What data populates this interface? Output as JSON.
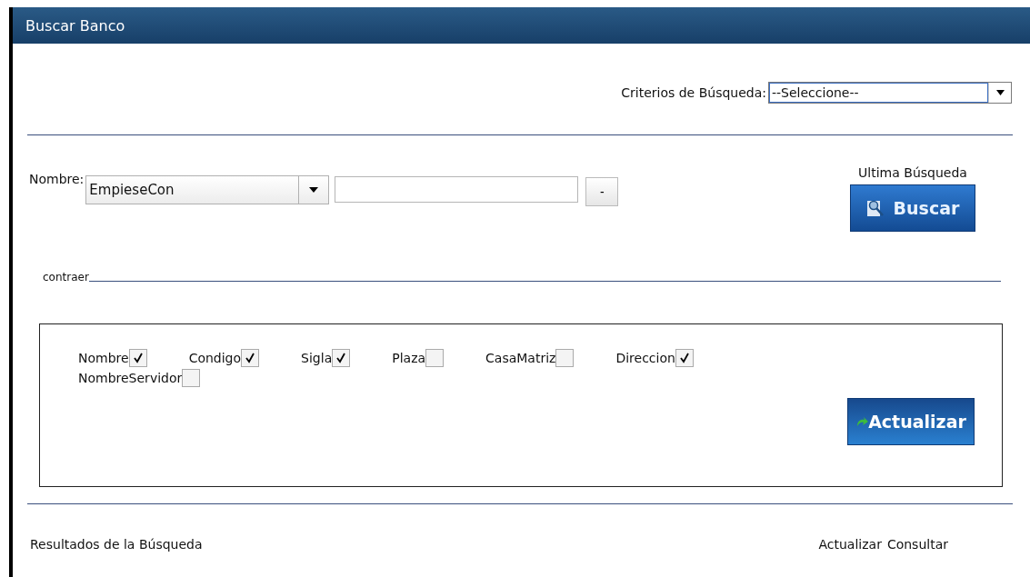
{
  "window": {
    "title": "Buscar Banco"
  },
  "criteria": {
    "label": "Criterios de Búsqueda:",
    "value": "--Seleccione--"
  },
  "name_filter": {
    "label": "Nombre:",
    "operator": "EmpieseCon",
    "remove_button": "-"
  },
  "last_search": {
    "label": "Ultima Búsqueda",
    "button": "Buscar"
  },
  "collapse": {
    "label": "contraer"
  },
  "columns": [
    {
      "label": "Nombre",
      "checked": true
    },
    {
      "label": "Condigo",
      "checked": true
    },
    {
      "label": "Sigla",
      "checked": true
    },
    {
      "label": "Plaza",
      "checked": false
    },
    {
      "label": "CasaMatriz",
      "checked": false
    },
    {
      "label": "Direccion",
      "checked": true
    },
    {
      "label": "NombreServidor",
      "checked": false
    }
  ],
  "update_button": "Actualizar",
  "results": {
    "title": "Resultados de la Búsqueda",
    "links": [
      "Actualizar",
      "Consultar"
    ]
  }
}
